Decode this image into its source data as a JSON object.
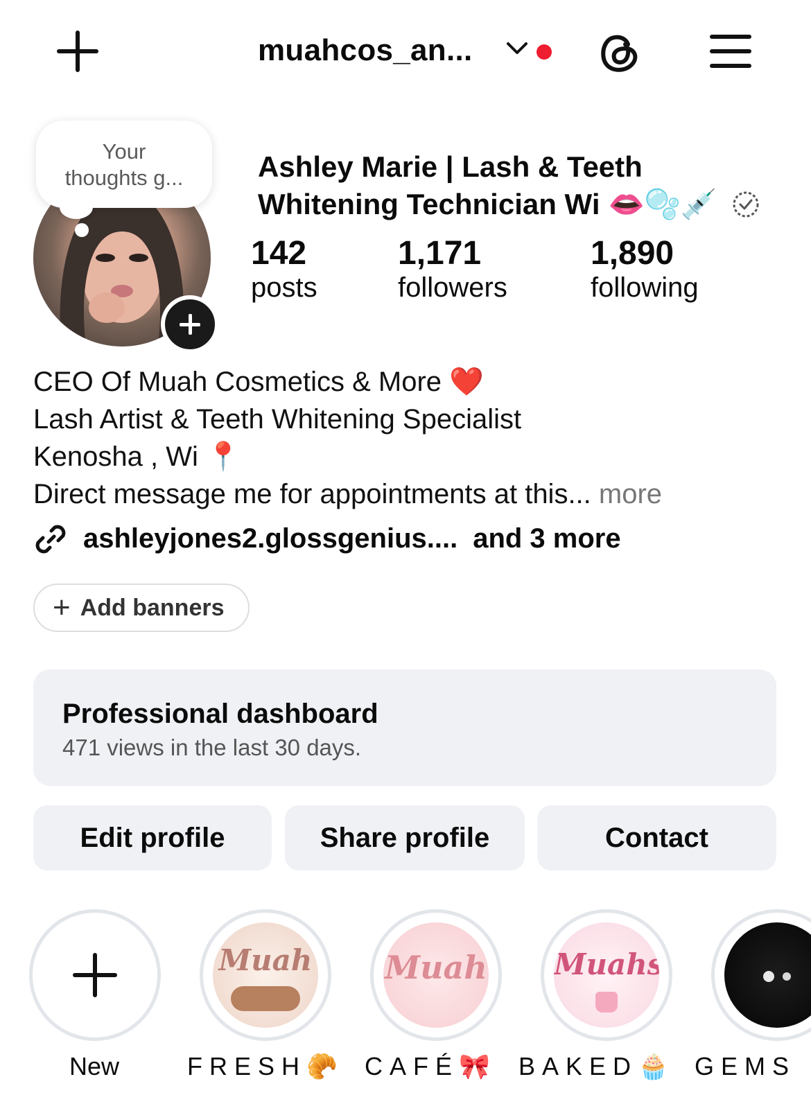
{
  "header": {
    "username": "muahcos_an...",
    "chevron_icon": "chevron-down-icon",
    "notification_dot_color": "#ee1d2f",
    "threads_icon": "threads-icon",
    "menu_icon": "menu-icon"
  },
  "note": {
    "line1": "Your",
    "line2": "thoughts g..."
  },
  "profile": {
    "name_line1": "Ashley Marie | Lash & Teeth",
    "name_line2": "Whitening Technician Wi",
    "name_emojis": "👄🫧💉"
  },
  "stats": [
    {
      "value": "142",
      "label": "posts"
    },
    {
      "value": "1,171",
      "label": "followers"
    },
    {
      "value": "1,890",
      "label": "following"
    }
  ],
  "bio": {
    "line1": "CEO Of Muah Cosmetics & More",
    "line1_emoji": "❤️",
    "line2": "Lash Artist & Teeth Whitening Specialist",
    "line3": "Kenosha , Wi",
    "line3_emoji": "📍",
    "line4": "Direct message me for appointments at this...",
    "more": "more"
  },
  "link": {
    "url": "ashleyjones2.glossgenius....",
    "extra": "and 3 more"
  },
  "banners": {
    "label": "Add banners"
  },
  "dashboard": {
    "title": "Professional dashboard",
    "subtitle": "471 views in the last 30 days."
  },
  "buttons": {
    "edit": "Edit profile",
    "share": "Share profile",
    "contact": "Contact"
  },
  "highlights": [
    {
      "label": "New",
      "logo": ""
    },
    {
      "label": "FRESH🥐",
      "logo": "Muah"
    },
    {
      "label": "CAFÉ🎀",
      "logo": "Muah"
    },
    {
      "label": "BAKED🧁",
      "logo": "Muahs"
    },
    {
      "label": "GEMS",
      "logo": ""
    }
  ]
}
